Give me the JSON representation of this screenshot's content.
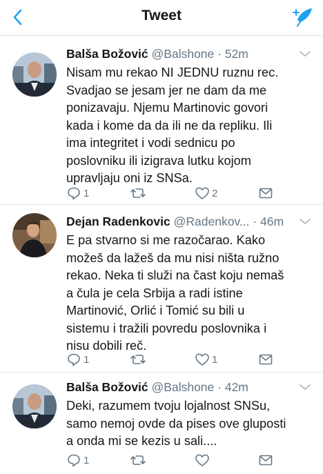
{
  "header": {
    "title": "Tweet",
    "accent_color": "#1da1f2"
  },
  "tweets": [
    {
      "name": "Balša Božović",
      "handle": "@Balshone",
      "time": "· 52m",
      "lines": [
        "Nisam mu rekao NI JEDNU ruznu rec.",
        "Svadjao se jesam jer ne dam da me",
        "ponizavaju. Njemu Martinovic govori",
        "kada i kome da da ili ne da repliku. Ili",
        "ima integritet i vodi sednicu po",
        "poslovniku ili izigrava lutku kojom",
        "upravljaju oni iz SNSa."
      ],
      "reply_count": "1",
      "retweet_count": "",
      "like_count": "2"
    },
    {
      "name": "Dejan Radenkovic",
      "handle": "@Radenkov...",
      "time": "· 46m",
      "lines": [
        "E pa stvarno si me razočarao. Kako",
        "možeš da lažeš da mu nisi ništa ružno",
        "rekao. Neka ti služi na čast koju nemaš",
        "a čula je cela Srbija a radi istine",
        "Martinović, Orlić i Tomić su bili u",
        "sistemu i tražili povredu poslovnika i",
        "nisu dobili reč."
      ],
      "reply_count": "1",
      "retweet_count": "",
      "like_count": "1"
    },
    {
      "name": "Balša Božović",
      "handle": "@Balshone",
      "time": "· 42m",
      "lines": [
        "Deki, razumem tvoju lojalnost SNSu,",
        "samo nemoj ovde da pises ove gluposti",
        "a onda mi se kezis u sali...."
      ],
      "reply_count": "1",
      "retweet_count": "",
      "like_count": ""
    }
  ],
  "icons": {
    "back": "chevron-left-icon",
    "compose": "compose-tweet-icon",
    "reply": "reply-icon",
    "retweet": "retweet-icon",
    "like": "heart-icon",
    "dm": "envelope-icon",
    "more": "chevron-down-icon"
  }
}
